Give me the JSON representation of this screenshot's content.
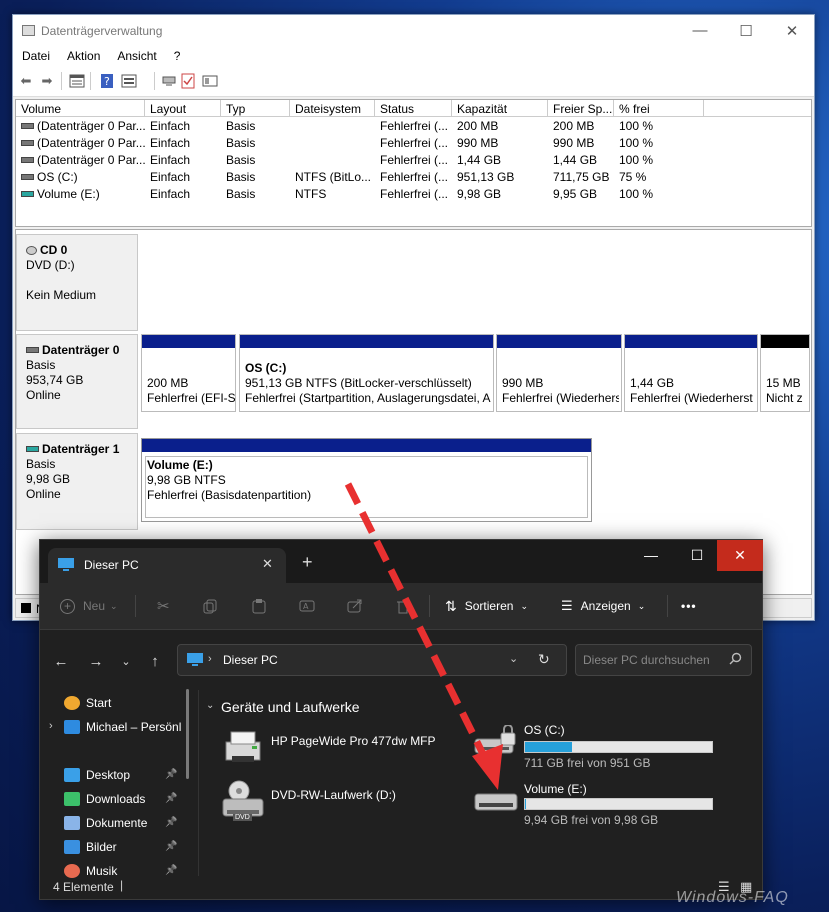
{
  "disk_mgmt": {
    "title": "Datenträgerverwaltung",
    "window_controls": {
      "min": "—",
      "max": "☐",
      "close": "✕"
    },
    "menu": [
      "Datei",
      "Aktion",
      "Ansicht",
      "?"
    ],
    "columns": [
      "Volume",
      "Layout",
      "Typ",
      "Dateisystem",
      "Status",
      "Kapazität",
      "Freier Sp...",
      "% frei"
    ],
    "rows": [
      [
        "(Datenträger 0 Par...",
        "Einfach",
        "Basis",
        "",
        "Fehlerfrei (...",
        "200 MB",
        "200 MB",
        "100 %"
      ],
      [
        "(Datenträger 0 Par...",
        "Einfach",
        "Basis",
        "",
        "Fehlerfrei (...",
        "990 MB",
        "990 MB",
        "100 %"
      ],
      [
        "(Datenträger 0 Par...",
        "Einfach",
        "Basis",
        "",
        "Fehlerfrei (...",
        "1,44 GB",
        "1,44 GB",
        "100 %"
      ],
      [
        "OS (C:)",
        "Einfach",
        "Basis",
        "NTFS (BitLo...",
        "Fehlerfrei (...",
        "951,13 GB",
        "711,75 GB",
        "75 %"
      ],
      [
        "Volume (E:)",
        "Einfach",
        "Basis",
        "NTFS",
        "Fehlerfrei (...",
        "9,98 GB",
        "9,95 GB",
        "100 %"
      ]
    ],
    "cd0": {
      "name": "CD 0",
      "drive": "DVD (D:)",
      "media": "Kein Medium"
    },
    "disk0": {
      "name": "Datenträger 0",
      "type": "Basis",
      "size": "953,74 GB",
      "state": "Online",
      "partitions": [
        {
          "title": "",
          "l1": "200 MB",
          "l2": "Fehlerfrei (EFI-S"
        },
        {
          "title": "OS  (C:)",
          "l1": "951,13 GB NTFS (BitLocker-verschlüsselt)",
          "l2": "Fehlerfrei (Startpartition, Auslagerungsdatei, A"
        },
        {
          "title": "",
          "l1": "990 MB",
          "l2": "Fehlerfrei (Wiederhers"
        },
        {
          "title": "",
          "l1": "1,44 GB",
          "l2": "Fehlerfrei (Wiederherst"
        },
        {
          "title": "",
          "l1": "15 MB",
          "l2": "Nicht z"
        }
      ]
    },
    "disk1": {
      "name": "Datenträger 1",
      "type": "Basis",
      "size": "9,98 GB",
      "state": "Online",
      "partition": {
        "title": "Volume  (E:)",
        "l1": "9,98 GB NTFS",
        "l2": "Fehlerfrei (Basisdatenpartition)"
      }
    },
    "legend_fragment": "N"
  },
  "explorer": {
    "tab_title": "Dieser PC",
    "new_tab": "+",
    "window_controls": {
      "min": "—",
      "max": "☐",
      "close": "✕"
    },
    "cmd": {
      "new": "Neu",
      "sort": "Sortieren",
      "view": "Anzeigen",
      "more": "•••"
    },
    "address": "Dieser PC",
    "search_placeholder": "Dieser PC durchsuchen",
    "sidebar": [
      {
        "label": "Start",
        "icon": "home-icon",
        "color": "#f0a830",
        "pinned": false
      },
      {
        "label": "Michael – Persönl",
        "icon": "onedrive-icon",
        "color": "#2e8be0",
        "pinned": false
      },
      {
        "label": "Desktop",
        "icon": "desktop-icon",
        "color": "#3aa0e8",
        "pinned": true
      },
      {
        "label": "Downloads",
        "icon": "downloads-icon",
        "color": "#3cc06a",
        "pinned": true
      },
      {
        "label": "Dokumente",
        "icon": "documents-icon",
        "color": "#8ab4e8",
        "pinned": true
      },
      {
        "label": "Bilder",
        "icon": "pictures-icon",
        "color": "#3a90e0",
        "pinned": true
      },
      {
        "label": "Musik",
        "icon": "music-icon",
        "color": "#e86a50",
        "pinned": true
      }
    ],
    "section": "Geräte und Laufwerke",
    "devices": [
      {
        "name": "HP PageWide Pro 477dw MFP",
        "icon": "printer-icon"
      },
      {
        "name": "DVD-RW-Laufwerk (D:)",
        "icon": "dvd-drive-icon",
        "badge": "DVD"
      }
    ],
    "drives": [
      {
        "name": "OS (C:)",
        "free": "711 GB frei von 951 GB",
        "used_fraction": 0.25,
        "icon": "bitlocker-drive-icon"
      },
      {
        "name": "Volume (E:)",
        "free": "9,94 GB frei von 9,98 GB",
        "used_fraction": 0.004,
        "icon": "drive-icon"
      }
    ],
    "status": "4 Elemente"
  },
  "watermark": "Windows-FAQ",
  "colors": {
    "accent": "#26a0da",
    "partition_bar": "#0a1f8c",
    "arrow": "#e83030"
  }
}
